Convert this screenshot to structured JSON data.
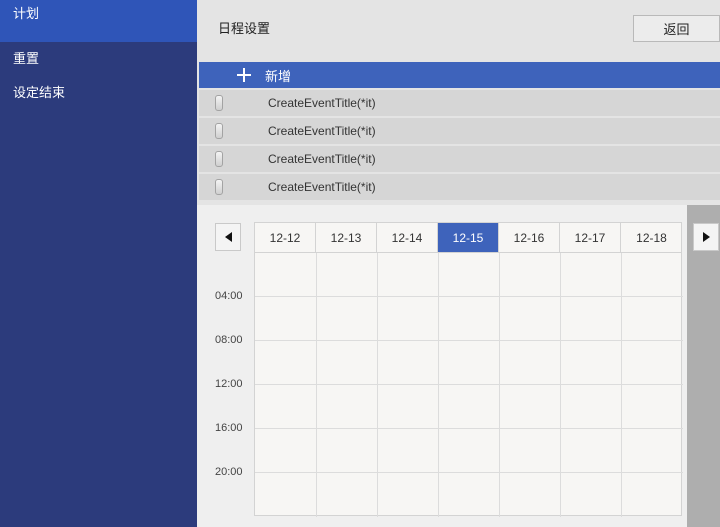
{
  "sidebar": {
    "items": [
      {
        "label": "计划",
        "active": true
      },
      {
        "label": "重置",
        "active": false
      },
      {
        "label": "设定结束",
        "active": false
      }
    ]
  },
  "header": {
    "title": "日程设置",
    "back_label": "返回"
  },
  "events": {
    "add_label": "新增",
    "items": [
      {
        "title": "CreateEventTitle(*it)"
      },
      {
        "title": "CreateEventTitle(*it)"
      },
      {
        "title": "CreateEventTitle(*it)"
      },
      {
        "title": "CreateEventTitle(*it)"
      }
    ]
  },
  "calendar": {
    "days": [
      "12-12",
      "12-13",
      "12-14",
      "12-15",
      "12-16",
      "12-17",
      "12-18"
    ],
    "selected_day": "12-15",
    "times": [
      "04:00",
      "08:00",
      "12:00",
      "16:00",
      "20:00"
    ]
  },
  "colors": {
    "sidebar_bg": "#2c3b7c",
    "accent": "#3e63bb"
  }
}
